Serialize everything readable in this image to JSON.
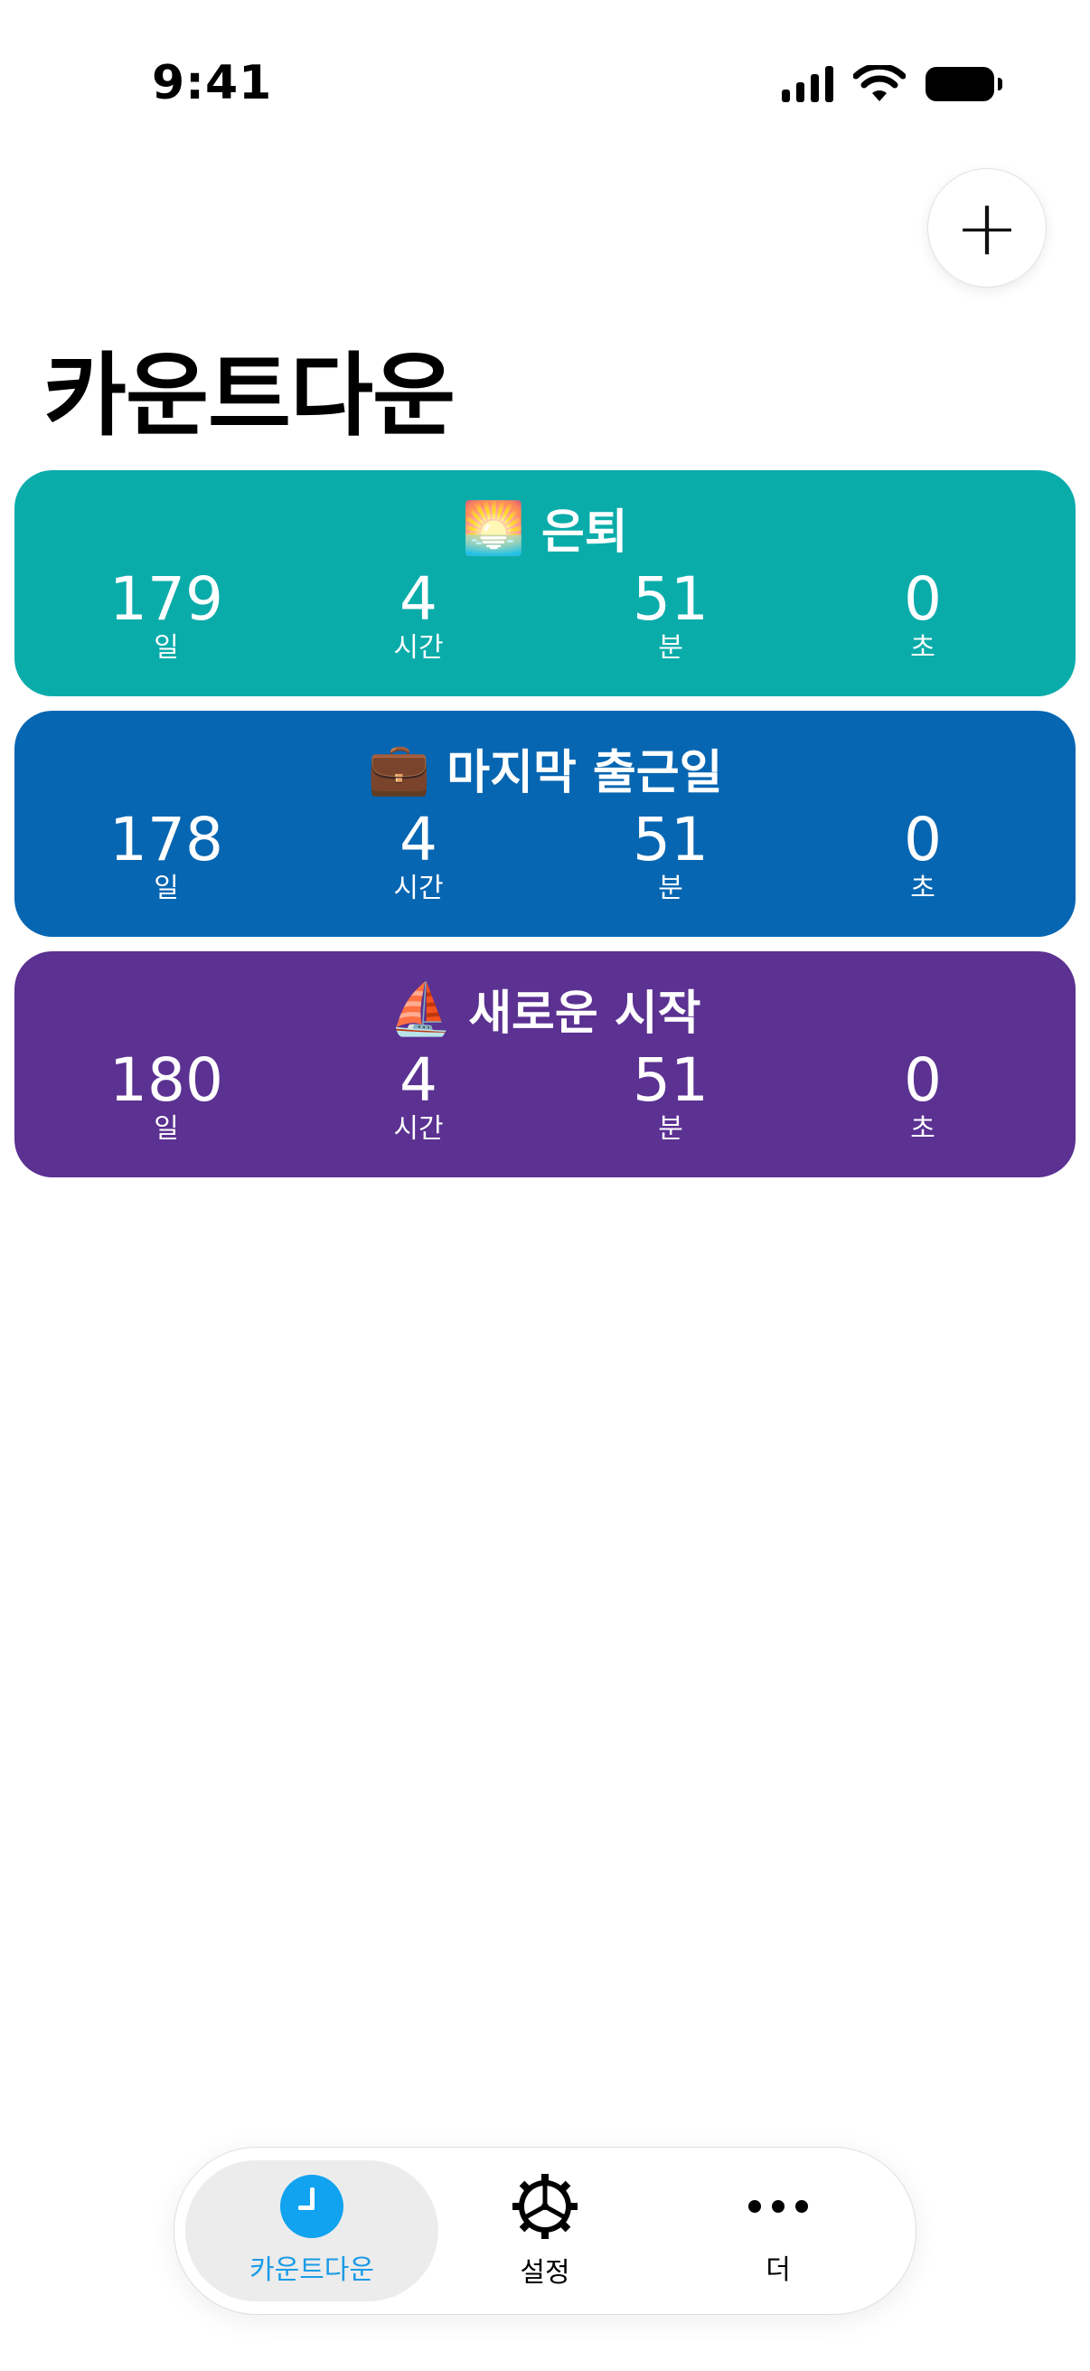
{
  "status_bar": {
    "time": "9:41"
  },
  "header": {
    "add_label": "+",
    "title": "카운트다운"
  },
  "colors": {
    "card_1": "#0AACAA",
    "card_2": "#0666B2",
    "card_3": "#5B3192",
    "accent": "#11A2F0"
  },
  "units": {
    "days": "일",
    "hours": "시간",
    "minutes": "분",
    "seconds": "초"
  },
  "countdowns": [
    {
      "icon": "sunrise-icon",
      "emoji": "🌅",
      "title": "은퇴",
      "days": "179",
      "hours": "4",
      "minutes": "51",
      "seconds": "0"
    },
    {
      "icon": "briefcase-icon",
      "emoji": "💼",
      "title": "마지막 출근일",
      "days": "178",
      "hours": "4",
      "minutes": "51",
      "seconds": "0"
    },
    {
      "icon": "sailboat-icon",
      "emoji": "⛵",
      "title": "새로운 시작",
      "days": "180",
      "hours": "4",
      "minutes": "51",
      "seconds": "0"
    }
  ],
  "tab_bar": {
    "tabs": [
      {
        "label": "카운트다운",
        "icon": "clock-icon",
        "active": true
      },
      {
        "label": "설정",
        "icon": "gear-icon",
        "active": false
      },
      {
        "label": "더",
        "icon": "more-icon",
        "active": false
      }
    ]
  }
}
